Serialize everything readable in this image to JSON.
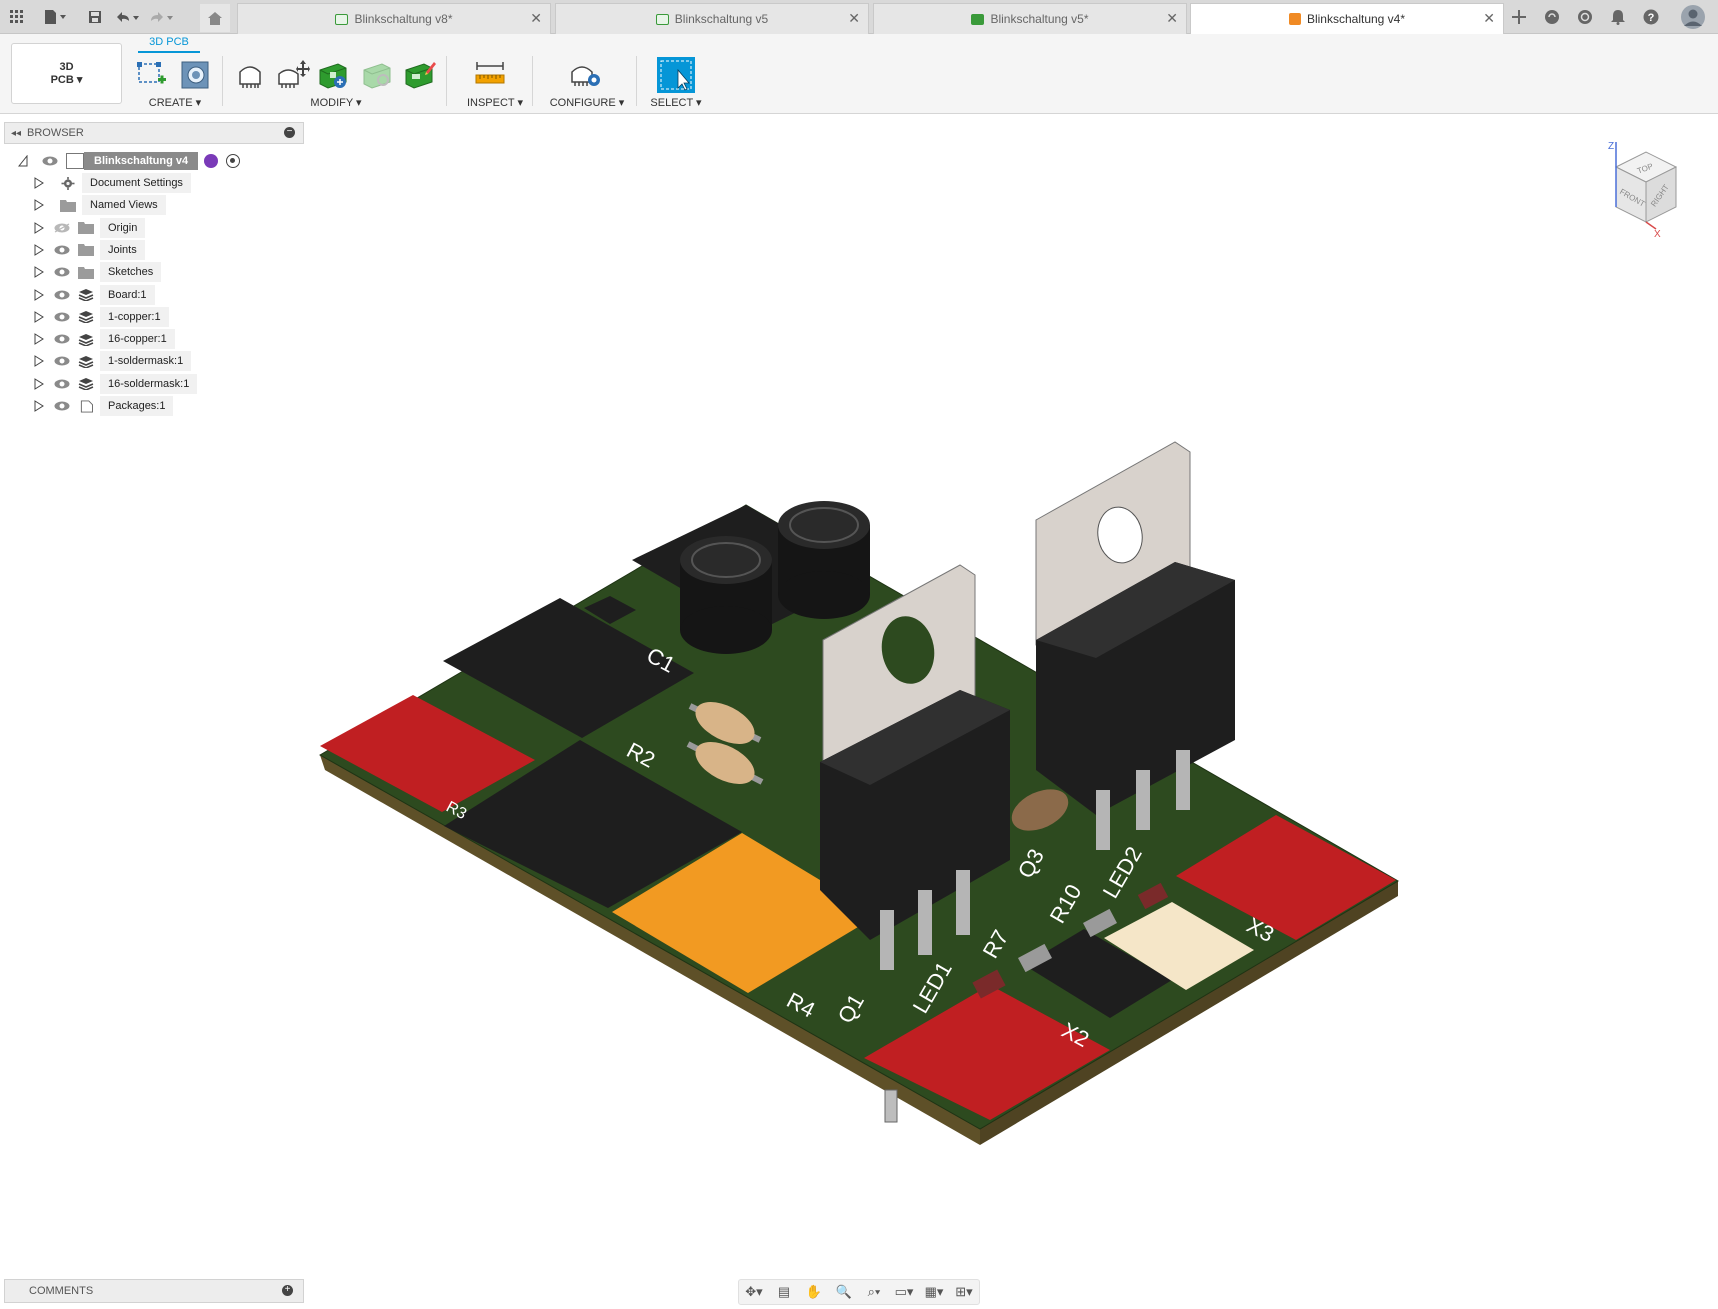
{
  "topbar": {
    "tabs": [
      {
        "label": "Blinkschaltung v8*",
        "active": false
      },
      {
        "label": "Blinkschaltung v5",
        "active": false
      },
      {
        "label": "Blinkschaltung v5*",
        "active": false
      },
      {
        "label": "Blinkschaltung v4*",
        "active": true
      }
    ]
  },
  "toolbar": {
    "workspace_line1": "3D",
    "workspace_line2": "PCB",
    "workspace_tab": "3D PCB",
    "groups": {
      "create": "CREATE ▾",
      "modify": "MODIFY ▾",
      "inspect": "INSPECT ▾",
      "configure": "CONFIGURE ▾",
      "select": "SELECT ▾"
    }
  },
  "browser": {
    "title": "BROWSER",
    "root": "Blinkschaltung v4",
    "items": [
      {
        "label": "Document Settings",
        "icon": "gear-icon"
      },
      {
        "label": "Named Views",
        "icon": "folder-icon"
      },
      {
        "label": "Origin",
        "icon": "folder-icon"
      },
      {
        "label": "Joints",
        "icon": "folder-icon"
      },
      {
        "label": "Sketches",
        "icon": "folder-icon"
      },
      {
        "label": "Board:1",
        "icon": "layer-icon"
      },
      {
        "label": "1-copper:1",
        "icon": "layer-icon"
      },
      {
        "label": "16-copper:1",
        "icon": "layer-icon"
      },
      {
        "label": "1-soldermask:1",
        "icon": "layer-icon"
      },
      {
        "label": "16-soldermask:1",
        "icon": "layer-icon"
      },
      {
        "label": "Packages:1",
        "icon": "component-icon"
      }
    ]
  },
  "comments": {
    "title": "COMMENTS"
  },
  "viewcube": {
    "top": "TOP",
    "front": "FRONT",
    "right": "RIGHT",
    "z": "Z",
    "x": "X"
  },
  "pcb": {
    "labels": {
      "c1": "C1",
      "r2": "R2",
      "r4": "R4",
      "q1": "Q1",
      "led1": "LED1",
      "r7": "R7",
      "r10": "R10",
      "led2": "LED2",
      "q3": "Q3",
      "x2": "X2",
      "x3": "X3",
      "r3": "R3"
    },
    "colors": {
      "board": "#2d4a1f",
      "pad_red": "#c01f22",
      "pad_orange": "#f29a22",
      "pad_cream": "#f5e6c8",
      "component_black": "#1e1e1e",
      "heatsink": "#d8d2cc"
    }
  }
}
